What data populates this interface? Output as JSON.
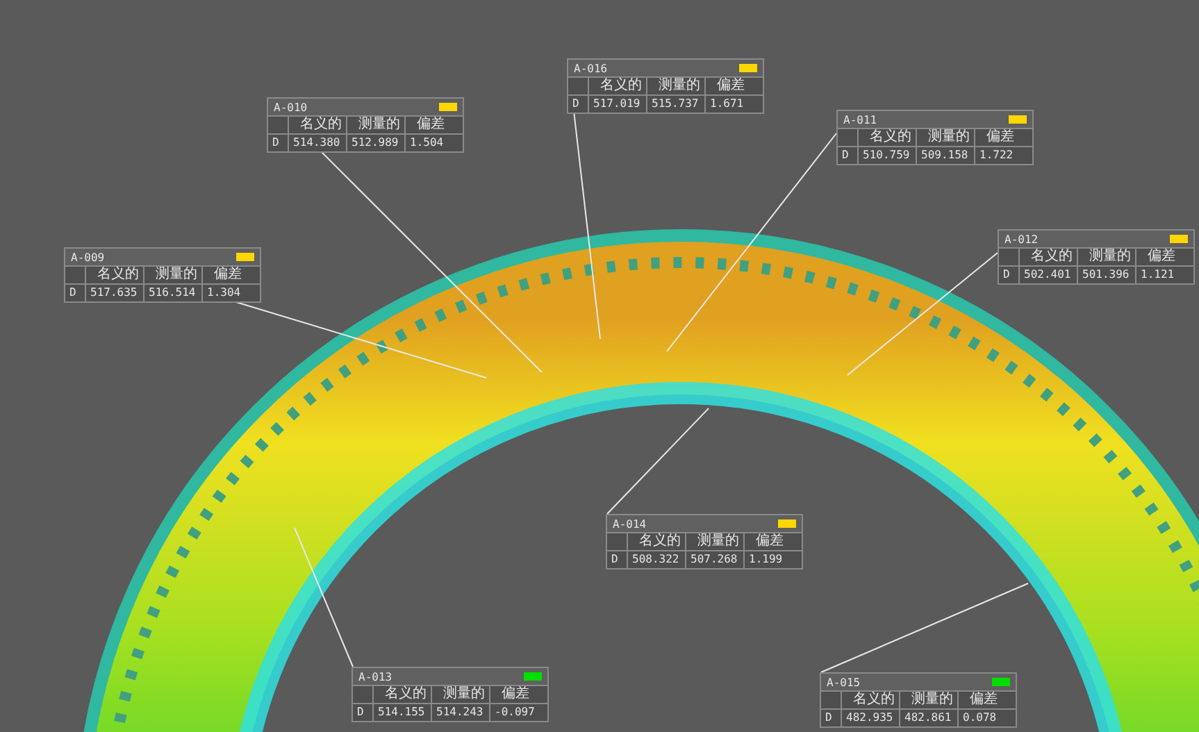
{
  "callouts": [
    {
      "title": "A-016",
      "color": "#ffd700",
      "columns": [
        "名义的",
        "测量的",
        "偏差"
      ],
      "row": [
        "D",
        "517.019",
        "515.737",
        "1.671"
      ]
    },
    {
      "title": "A-010",
      "color": "#ffd700",
      "columns": [
        "名义的",
        "测量的",
        "偏差"
      ],
      "row": [
        "D",
        "514.380",
        "512.989",
        "1.504"
      ]
    },
    {
      "title": "A-011",
      "color": "#ffd700",
      "columns": [
        "名义的",
        "测量的",
        "偏差"
      ],
      "row": [
        "D",
        "510.759",
        "509.158",
        "1.722"
      ]
    },
    {
      "title": "A-009",
      "color": "#ffd700",
      "columns": [
        "名义的",
        "测量的",
        "偏差"
      ],
      "row": [
        "D",
        "517.635",
        "516.514",
        "1.304"
      ]
    },
    {
      "title": "A-012",
      "color": "#ffd700",
      "columns": [
        "名义的",
        "测量的",
        "偏差"
      ],
      "row": [
        "D",
        "502.401",
        "501.396",
        "1.121"
      ]
    },
    {
      "title": "A-014",
      "color": "#ffd700",
      "columns": [
        "名义的",
        "测量的",
        "偏差"
      ],
      "row": [
        "D",
        "508.322",
        "507.268",
        "1.199"
      ]
    },
    {
      "title": "A-013",
      "color": "#00e000",
      "columns": [
        "名义的",
        "测量的",
        "偏差"
      ],
      "row": [
        "D",
        "514.155",
        "514.243",
        "-0.097"
      ]
    },
    {
      "title": "A-015",
      "color": "#00e000",
      "columns": [
        "名义的",
        "测量的",
        "偏差"
      ],
      "row": [
        "D",
        "482.935",
        "482.861",
        "0.078"
      ]
    }
  ]
}
